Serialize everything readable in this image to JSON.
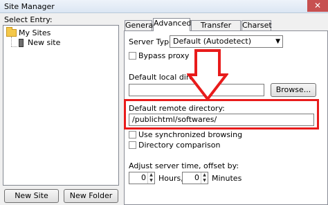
{
  "window": {
    "title": "Site Manager",
    "close_glyph": "✕"
  },
  "left": {
    "select_label": "Select Entry:",
    "tree": [
      {
        "label": "My Sites",
        "icon": "folder-icon"
      },
      {
        "label": "New site",
        "icon": "server-icon"
      }
    ],
    "new_site_button": "New Site",
    "new_folder_button": "New Folder"
  },
  "tabs": [
    "General",
    "Advanced",
    "Transfer Settings",
    "Charset"
  ],
  "active_tab": "Advanced",
  "advanced": {
    "server_type_label": "Server Type:",
    "server_type_value": "Default (Autodetect)",
    "bypass_proxy_label": "Bypass proxy",
    "default_local_dir_label": "Default local directory:",
    "default_local_dir_value": "",
    "browse_button": "Browse...",
    "default_remote_dir_label": "Default remote directory:",
    "default_remote_dir_value": "/publichtml/softwares/",
    "sync_browsing_label": "Use synchronized browsing",
    "dir_comparison_label": "Directory comparison",
    "adjust_time_label": "Adjust server time, offset by:",
    "hours_value": "0",
    "hours_label": "Hours,",
    "minutes_value": "0",
    "minutes_label": "Minutes"
  },
  "colors": {
    "highlight_red": "#e81b1b",
    "close_red": "#c75050"
  }
}
